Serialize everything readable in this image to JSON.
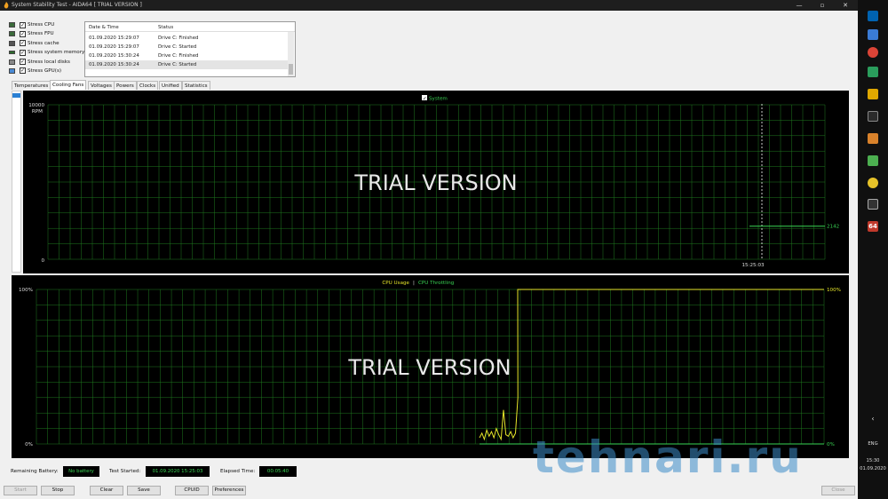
{
  "window": {
    "title": "System Stability Test - AIDA64  [ TRIAL VERSION ]",
    "minimize": "—",
    "maximize": "▫",
    "close": "✕"
  },
  "stress": [
    {
      "label": "Stress CPU",
      "checked": "✓"
    },
    {
      "label": "Stress FPU",
      "checked": "✓"
    },
    {
      "label": "Stress cache",
      "checked": "✓"
    },
    {
      "label": "Stress system memory",
      "checked": "✓"
    },
    {
      "label": "Stress local disks",
      "checked": "✓"
    },
    {
      "label": "Stress GPU(s)",
      "checked": "✓"
    }
  ],
  "log": {
    "headers": [
      "Date & Time",
      "Status"
    ],
    "rows": [
      [
        "01.09.2020 15:29:07",
        "Drive C: Finished"
      ],
      [
        "01.09.2020 15:29:07",
        "Drive C: Started"
      ],
      [
        "01.09.2020 15:30:24",
        "Drive C: Finished"
      ],
      [
        "01.09.2020 15:30:24",
        "Drive C: Started"
      ]
    ]
  },
  "tabs": [
    "Temperatures",
    "Cooling Fans",
    "Voltages",
    "Powers",
    "Clocks",
    "Unified",
    "Statistics"
  ],
  "active_tab": "Cooling Fans",
  "colors": {
    "grid": "#1f7a1f",
    "fan_line": "#39d353",
    "cpu_usage": "#e6e62a",
    "throttle": "#39d353",
    "trial_text": "#e8e8e8"
  },
  "fan_chart": {
    "legend": "System",
    "legend_check": "✓",
    "ymax_label": "10000",
    "yunit": "RPM",
    "ymin_label": "0",
    "time_label": "15:25:03",
    "value_label": "2142",
    "trial": "TRIAL VERSION"
  },
  "cpu_chart": {
    "legend_usage": "CPU Usage",
    "legend_sep": "|",
    "legend_throttle": "CPU Throttling",
    "ymax_left": "100%",
    "ymin_left": "0%",
    "ymax_right": "100%",
    "ymin_right": "0%",
    "trial": "TRIAL VERSION"
  },
  "chart_data": [
    {
      "type": "line",
      "title": "",
      "ylabel": "RPM",
      "ylim": [
        0,
        10000
      ],
      "series": [
        {
          "name": "System",
          "values": [
            2142
          ]
        }
      ],
      "x_tick": "15:25:03",
      "grid": true,
      "legend": "top-center"
    },
    {
      "type": "line",
      "title": "",
      "ylim": [
        0,
        100
      ],
      "series": [
        {
          "name": "CPU Usage",
          "values": [
            4,
            7,
            3,
            9,
            5,
            8,
            4,
            10,
            6,
            3,
            22,
            6,
            5,
            8,
            4,
            7,
            30,
            100,
            100,
            100,
            100,
            100,
            100
          ]
        },
        {
          "name": "CPU Throttling",
          "values": [
            0,
            0,
            0,
            0,
            0,
            0,
            0,
            0,
            0,
            0,
            0,
            0,
            0,
            0,
            0,
            0,
            0,
            0,
            0,
            0,
            0,
            0,
            0
          ]
        }
      ],
      "grid": true,
      "legend": "top-center"
    }
  ],
  "status": {
    "battery_label": "Remaining Battery:",
    "battery_value": "No battery",
    "started_label": "Test Started:",
    "started_value": "01.09.2020 15:25:03",
    "elapsed_label": "Elapsed Time:",
    "elapsed_value": "00:05:40"
  },
  "buttons": {
    "start": "Start",
    "stop": "Stop",
    "clear": "Clear",
    "save": "Save",
    "cpuid": "CPUID",
    "preferences": "Preferences",
    "close": "Close"
  },
  "taskbar": {
    "badge": "64",
    "lang": "ENG",
    "time": "15:30",
    "date": "01.09.2020",
    "chevron": "‹"
  },
  "watermark": "tehnari.ru"
}
